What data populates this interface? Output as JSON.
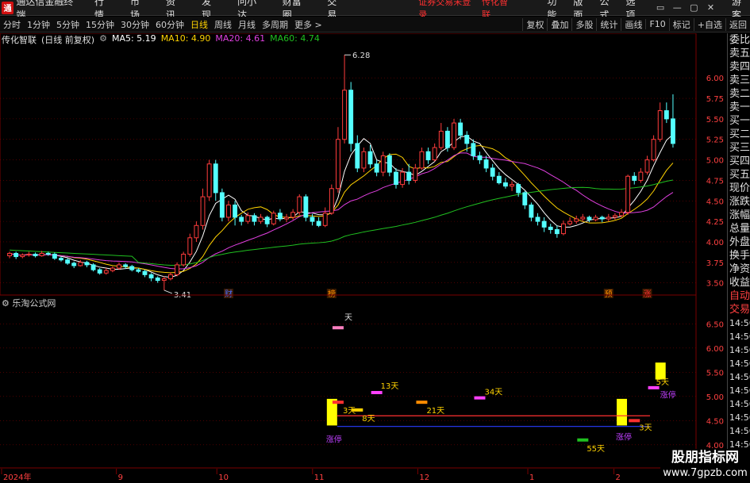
{
  "app": {
    "logo_glyph": "通",
    "title": "通达信金融终端",
    "menu": [
      "行情",
      "市场",
      "资讯",
      "发现",
      "问小达",
      "财富圈",
      "交易"
    ],
    "alert_1": "证券交易未登录",
    "alert_2": "传化智联",
    "right_menu": [
      "功能",
      "版面",
      "公式",
      "选项"
    ],
    "window_buttons": [
      "▭",
      "—",
      "▢",
      "✕"
    ],
    "guest": "游客"
  },
  "periods": {
    "items": [
      "分时",
      "1分钟",
      "5分钟",
      "15分钟",
      "30分钟",
      "60分钟",
      "日线",
      "周线",
      "月线",
      "多周期",
      "更多 >"
    ],
    "active": "日线"
  },
  "tools": [
    "复权",
    "叠加",
    "多股",
    "统计",
    "画线",
    "F10",
    "标记",
    "+自选",
    "返回"
  ],
  "stock": {
    "name": "传化智联",
    "mode": "(日线 前复权)",
    "ma5": "MA5: 5.19",
    "ma10": "MA10: 4.90",
    "ma20": "MA20: 4.61",
    "ma60": "MA60: 4.74"
  },
  "colors": {
    "up": "#ff3c3c",
    "down": "#54ffff",
    "ma5": "#ffffff",
    "ma10": "#ffd200",
    "ma20": "#e040e0",
    "ma60": "#20c020",
    "grid": "#7a0000"
  },
  "indicator": {
    "name": "乐淘公式网"
  },
  "right_panel": {
    "items": [
      "委比",
      "卖五",
      "卖四",
      "卖三",
      "卖二",
      "卖一",
      "买一",
      "买二",
      "买三",
      "买四",
      "买五",
      "现价",
      "涨跌",
      "涨幅",
      "总量",
      "外盘",
      "换手",
      "净资",
      "收益"
    ],
    "lower": [
      "自动",
      "交易"
    ],
    "times": [
      "14:56",
      "14:56",
      "14:56",
      "14:56",
      "14:56",
      "14:56",
      "14:56",
      "14:56",
      "14:56",
      "14:56"
    ]
  },
  "chart_data": [
    {
      "type": "candlestick",
      "title": "传化智联",
      "x_labels": [
        "2024年",
        "9",
        "10",
        "11",
        "12",
        "1",
        "2"
      ],
      "y_ticks": [
        "6.00",
        "5.75",
        "5.50",
        "5.25",
        "5.00",
        "4.75",
        "4.50",
        "4.25",
        "4.00",
        "3.75",
        "3.50"
      ],
      "ylim": [
        3.4,
        6.35
      ],
      "annotations": {
        "high": "6.28",
        "low": "3.41",
        "markers": [
          "财",
          "榜",
          "预",
          "涨"
        ]
      },
      "candles": [
        [
          3.83,
          3.86,
          3.8,
          3.88
        ],
        [
          3.86,
          3.82,
          3.79,
          3.88
        ],
        [
          3.82,
          3.84,
          3.8,
          3.86
        ],
        [
          3.84,
          3.85,
          3.82,
          3.88
        ],
        [
          3.85,
          3.83,
          3.81,
          3.87
        ],
        [
          3.83,
          3.86,
          3.82,
          3.89
        ],
        [
          3.86,
          3.85,
          3.83,
          3.88
        ],
        [
          3.85,
          3.8,
          3.78,
          3.87
        ],
        [
          3.8,
          3.78,
          3.76,
          3.82
        ],
        [
          3.78,
          3.74,
          3.72,
          3.8
        ],
        [
          3.74,
          3.71,
          3.68,
          3.76
        ],
        [
          3.71,
          3.75,
          3.7,
          3.78
        ],
        [
          3.75,
          3.72,
          3.69,
          3.77
        ],
        [
          3.72,
          3.66,
          3.64,
          3.74
        ],
        [
          3.66,
          3.62,
          3.6,
          3.68
        ],
        [
          3.62,
          3.65,
          3.6,
          3.68
        ],
        [
          3.65,
          3.68,
          3.63,
          3.7
        ],
        [
          3.68,
          3.72,
          3.66,
          3.75
        ],
        [
          3.72,
          3.7,
          3.67,
          3.74
        ],
        [
          3.7,
          3.66,
          3.64,
          3.72
        ],
        [
          3.66,
          3.64,
          3.62,
          3.68
        ],
        [
          3.64,
          3.6,
          3.57,
          3.66
        ],
        [
          3.6,
          3.56,
          3.52,
          3.62
        ],
        [
          3.56,
          3.53,
          3.5,
          3.58
        ],
        [
          3.53,
          3.55,
          3.41,
          3.58
        ],
        [
          3.55,
          3.6,
          3.53,
          3.63
        ],
        [
          3.6,
          3.72,
          3.58,
          3.75
        ],
        [
          3.72,
          3.85,
          3.7,
          3.88
        ],
        [
          3.85,
          4.05,
          3.82,
          4.1
        ],
        [
          4.05,
          4.2,
          4.0,
          4.25
        ],
        [
          4.2,
          4.55,
          4.15,
          4.65
        ],
        [
          4.55,
          4.95,
          4.5,
          5.0
        ],
        [
          4.95,
          4.6,
          4.5,
          5.0
        ],
        [
          4.6,
          4.3,
          4.25,
          4.65
        ],
        [
          4.3,
          4.45,
          4.25,
          4.5
        ],
        [
          4.45,
          4.3,
          4.2,
          4.5
        ],
        [
          4.3,
          4.25,
          4.2,
          4.33
        ],
        [
          4.25,
          4.32,
          4.22,
          4.36
        ],
        [
          4.32,
          4.25,
          4.2,
          4.35
        ],
        [
          4.25,
          4.3,
          4.22,
          4.34
        ],
        [
          4.3,
          4.22,
          4.18,
          4.32
        ],
        [
          4.22,
          4.35,
          4.2,
          4.38
        ],
        [
          4.35,
          4.28,
          4.25,
          4.4
        ],
        [
          4.28,
          4.3,
          4.24,
          4.34
        ],
        [
          4.3,
          4.36,
          4.27,
          4.4
        ],
        [
          4.36,
          4.55,
          4.33,
          4.58
        ],
        [
          4.55,
          4.3,
          4.25,
          4.58
        ],
        [
          4.3,
          4.25,
          4.2,
          4.34
        ],
        [
          4.25,
          4.2,
          4.18,
          4.3
        ],
        [
          4.2,
          4.35,
          4.18,
          4.42
        ],
        [
          4.35,
          4.65,
          4.33,
          4.7
        ],
        [
          4.65,
          5.25,
          4.6,
          5.4
        ],
        [
          5.25,
          5.85,
          5.2,
          6.28
        ],
        [
          5.85,
          5.2,
          5.1,
          5.95
        ],
        [
          5.2,
          4.9,
          4.85,
          5.3
        ],
        [
          4.9,
          5.1,
          4.85,
          5.15
        ],
        [
          5.1,
          4.95,
          4.9,
          5.18
        ],
        [
          4.95,
          4.85,
          4.8,
          5.0
        ],
        [
          4.85,
          5.05,
          4.8,
          5.1
        ],
        [
          5.05,
          4.85,
          4.8,
          5.08
        ],
        [
          4.85,
          4.7,
          4.65,
          4.9
        ],
        [
          4.7,
          4.85,
          4.66,
          4.9
        ],
        [
          4.85,
          4.75,
          4.7,
          4.95
        ],
        [
          4.75,
          4.9,
          4.72,
          4.95
        ],
        [
          4.9,
          5.1,
          4.88,
          5.15
        ],
        [
          5.1,
          5.0,
          4.95,
          5.15
        ],
        [
          5.0,
          5.15,
          4.98,
          5.2
        ],
        [
          5.15,
          5.35,
          5.12,
          5.45
        ],
        [
          5.35,
          5.15,
          5.1,
          5.4
        ],
        [
          5.15,
          5.45,
          5.12,
          5.5
        ],
        [
          5.45,
          5.3,
          5.25,
          5.5
        ],
        [
          5.3,
          5.2,
          5.1,
          5.35
        ],
        [
          5.2,
          5.05,
          5.0,
          5.25
        ],
        [
          5.05,
          5.0,
          4.95,
          5.1
        ],
        [
          5.0,
          4.9,
          4.85,
          5.05
        ],
        [
          4.9,
          4.8,
          4.75,
          4.95
        ],
        [
          4.8,
          4.72,
          4.7,
          4.85
        ],
        [
          4.72,
          4.68,
          4.65,
          4.78
        ],
        [
          4.68,
          4.7,
          4.62,
          4.74
        ],
        [
          4.7,
          4.6,
          4.55,
          4.72
        ],
        [
          4.6,
          4.45,
          4.4,
          4.62
        ],
        [
          4.45,
          4.3,
          4.25,
          4.48
        ],
        [
          4.3,
          4.25,
          4.2,
          4.35
        ],
        [
          4.25,
          4.18,
          4.12,
          4.3
        ],
        [
          4.18,
          4.15,
          4.1,
          4.22
        ],
        [
          4.15,
          4.1,
          4.05,
          4.2
        ],
        [
          4.1,
          4.22,
          4.08,
          4.26
        ],
        [
          4.22,
          4.25,
          4.2,
          4.3
        ],
        [
          4.25,
          4.28,
          4.22,
          4.32
        ],
        [
          4.28,
          4.3,
          4.25,
          4.34
        ],
        [
          4.3,
          4.27,
          4.24,
          4.32
        ],
        [
          4.27,
          4.3,
          4.25,
          4.33
        ],
        [
          4.3,
          4.28,
          4.24,
          4.32
        ],
        [
          4.28,
          4.3,
          4.25,
          4.34
        ],
        [
          4.3,
          4.32,
          4.27,
          4.35
        ],
        [
          4.32,
          4.36,
          4.3,
          4.4
        ],
        [
          4.36,
          4.8,
          4.33,
          4.82
        ],
        [
          4.8,
          4.75,
          4.7,
          4.85
        ],
        [
          4.75,
          4.85,
          4.72,
          4.9
        ],
        [
          4.85,
          5.0,
          4.82,
          5.05
        ],
        [
          5.0,
          5.25,
          4.98,
          5.3
        ],
        [
          5.25,
          5.6,
          5.22,
          5.7
        ],
        [
          5.6,
          5.5,
          5.45,
          5.7
        ],
        [
          5.5,
          5.2,
          5.15,
          5.8
        ]
      ]
    },
    {
      "type": "indicator",
      "title": "乐淘公式网",
      "y_ticks": [
        "6.50",
        "6.00",
        "5.50",
        "5.00",
        "4.50",
        "4.00"
      ],
      "ylim": [
        3.85,
        6.85
      ],
      "labels": [
        "3天",
        "8天",
        "13天",
        "21天",
        "34天",
        "55天",
        "3天",
        "5天"
      ],
      "limit_up_labels": [
        "涨停",
        "涨停",
        "涨停"
      ],
      "top_label": "天"
    }
  ]
}
